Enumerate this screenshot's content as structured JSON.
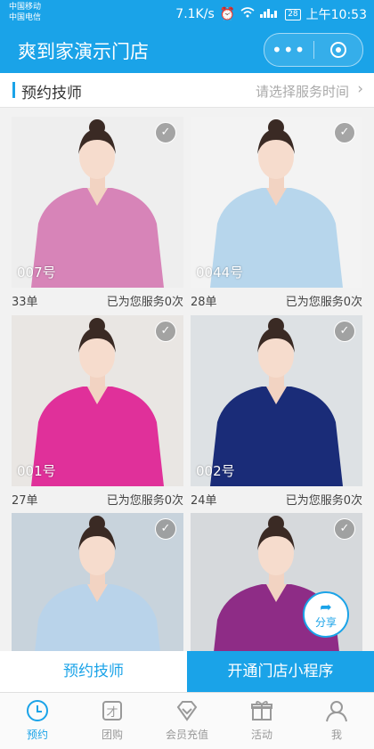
{
  "status_bar": {
    "carrier1": "中国移动",
    "carrier2": "中国电信",
    "speed": "7.1K/s",
    "battery": "28",
    "time": "上午10:53"
  },
  "titlebar": {
    "title": "爽到家演示门店"
  },
  "section": {
    "title": "预约技师",
    "time_link": "请选择服务时间"
  },
  "technicians": [
    {
      "label": "007号",
      "orders": "33单",
      "served": "已为您服务0次",
      "uniform_color": "#d784b8",
      "bg": "#eeeeee"
    },
    {
      "label": "0044号",
      "orders": "28单",
      "served": "已为您服务0次",
      "uniform_color": "#b7d6ec",
      "bg": "#f3f3f3"
    },
    {
      "label": "001号",
      "orders": "27单",
      "served": "已为您服务0次",
      "uniform_color": "#e0309a",
      "bg": "#e9e6e3"
    },
    {
      "label": "002号",
      "orders": "24单",
      "served": "已为您服务0次",
      "uniform_color": "#1a2c78",
      "bg": "#dde1e4"
    },
    {
      "label": "",
      "orders": "",
      "served": "",
      "uniform_color": "#b9d3ea",
      "bg": "#c8d3dc"
    },
    {
      "label": "",
      "orders": "",
      "served": "",
      "uniform_color": "#8e2c86",
      "bg": "#d6d9dc"
    }
  ],
  "share": {
    "label": "分享"
  },
  "actions": {
    "book": "预约技师",
    "open": "开通门店小程序"
  },
  "tabs": [
    {
      "label": "预约",
      "icon": "clock-icon"
    },
    {
      "label": "团购",
      "icon": "group-buy-icon"
    },
    {
      "label": "会员充值",
      "icon": "diamond-icon"
    },
    {
      "label": "活动",
      "icon": "gift-icon"
    },
    {
      "label": "我",
      "icon": "person-icon"
    }
  ],
  "colors": {
    "accent": "#1aa3e8"
  }
}
